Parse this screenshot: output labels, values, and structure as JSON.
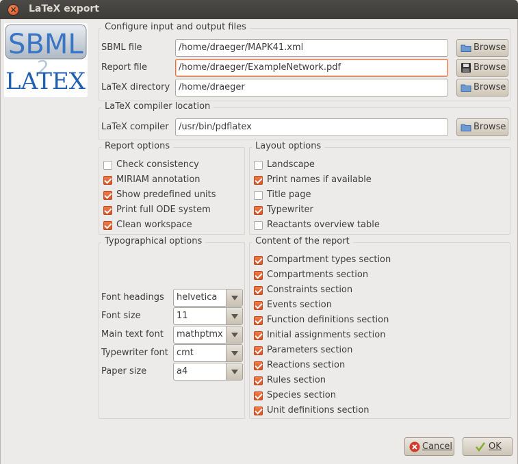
{
  "window": {
    "title": "LaTeX export"
  },
  "logo": {
    "top_text": "SBML",
    "to_digit": "2",
    "bottom_text": "LATEX"
  },
  "io_group": {
    "title": "Configure input and output files",
    "sbml": {
      "label": "SBML file",
      "value": "/home/draeger/MAPK41.xml",
      "button": "Browse"
    },
    "report": {
      "label": "Report file",
      "value": "/home/draeger/ExampleNetwork.pdf",
      "button": "Browse"
    },
    "latexdir": {
      "label": "LaTeX directory",
      "value": "/home/draeger",
      "button": "Browse"
    }
  },
  "compiler_group": {
    "title": "LaTeX compiler location",
    "compiler": {
      "label": "LaTeX compiler",
      "value": "/usr/bin/pdflatex",
      "button": "Browse"
    }
  },
  "report_options": {
    "title": "Report options",
    "items": [
      {
        "label": "Check consistency",
        "checked": false
      },
      {
        "label": "MIRIAM annotation",
        "checked": true
      },
      {
        "label": "Show predefined units",
        "checked": true
      },
      {
        "label": "Print full ODE system",
        "checked": true
      },
      {
        "label": "Clean workspace",
        "checked": true
      }
    ]
  },
  "layout_options": {
    "title": "Layout options",
    "items": [
      {
        "label": "Landscape",
        "checked": false
      },
      {
        "label": "Print names if available",
        "checked": true
      },
      {
        "label": "Title page",
        "checked": false
      },
      {
        "label": "Typewriter",
        "checked": true
      },
      {
        "label": "Reactants overview table",
        "checked": false
      }
    ]
  },
  "typo_options": {
    "title": "Typographical options",
    "rows": [
      {
        "label": "Font headings",
        "value": "helvetica"
      },
      {
        "label": "Font size",
        "value": "11"
      },
      {
        "label": "Main text font",
        "value": "mathptmx"
      },
      {
        "label": "Typewriter font",
        "value": "cmt"
      },
      {
        "label": "Paper size",
        "value": "a4"
      }
    ]
  },
  "content": {
    "title": "Content of the report",
    "items": [
      {
        "label": "Compartment types section",
        "checked": true
      },
      {
        "label": "Compartments section",
        "checked": true
      },
      {
        "label": "Constraints section",
        "checked": true
      },
      {
        "label": "Events section",
        "checked": true
      },
      {
        "label": "Function definitions section",
        "checked": true
      },
      {
        "label": "Initial assignments section",
        "checked": true
      },
      {
        "label": "Parameters section",
        "checked": true
      },
      {
        "label": "Reactions section",
        "checked": true
      },
      {
        "label": "Rules section",
        "checked": true
      },
      {
        "label": "Species section",
        "checked": true
      },
      {
        "label": "Unit definitions section",
        "checked": true
      }
    ]
  },
  "buttons": {
    "cancel": "Cancel",
    "ok": "OK"
  },
  "colors": {
    "accent": "#e0703f",
    "check": "#d6562a",
    "titlebar": "#3d3c38"
  }
}
